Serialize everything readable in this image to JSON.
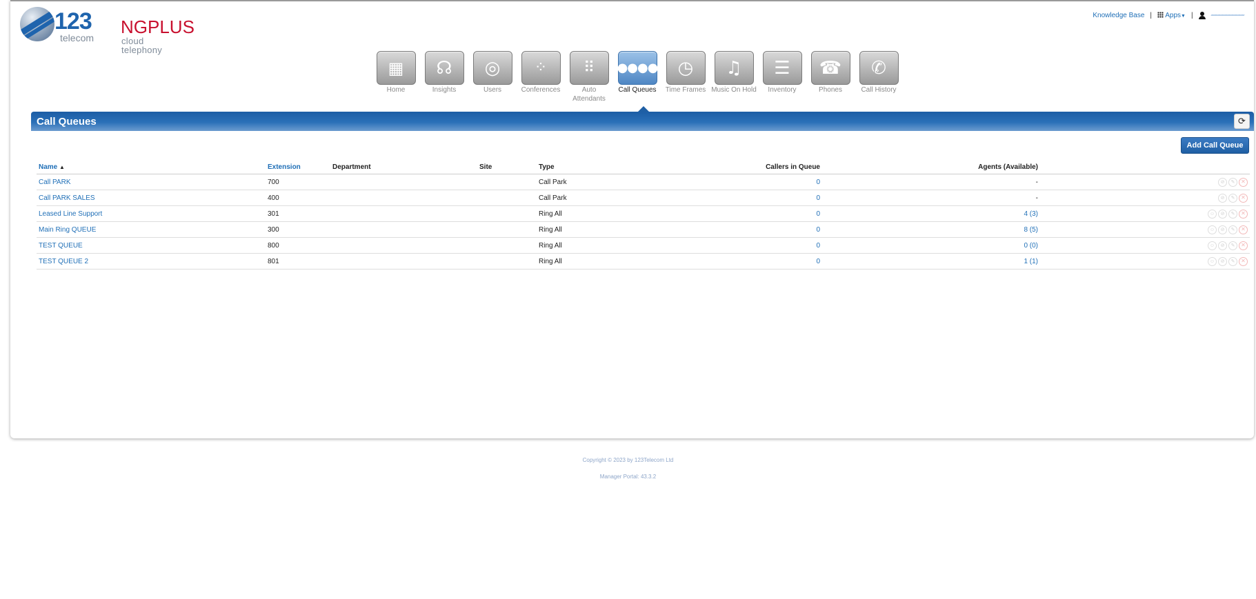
{
  "header": {
    "logo_number": "123",
    "logo_sub": "telecom",
    "brand_name": "NGPLUS",
    "brand_tag": "cloud telephony",
    "knowledge_base": "Knowledge Base",
    "apps": "Apps",
    "user_name": "~~~~~~~~~~"
  },
  "nav": {
    "items": [
      {
        "label": "Home",
        "icon": "building-icon"
      },
      {
        "label": "Insights",
        "icon": "headset-icon"
      },
      {
        "label": "Users",
        "icon": "user-circle-icon"
      },
      {
        "label": "Conferences",
        "icon": "conference-icon"
      },
      {
        "label": "Auto Attendants",
        "icon": "keypad-icon"
      },
      {
        "label": "Call Queues",
        "icon": "dots-icon"
      },
      {
        "label": "Time Frames",
        "icon": "clock-icon"
      },
      {
        "label": "Music On Hold",
        "icon": "music-note-icon"
      },
      {
        "label": "Inventory",
        "icon": "list-icon"
      },
      {
        "label": "Phones",
        "icon": "handset-icon"
      },
      {
        "label": "Call History",
        "icon": "call-history-icon"
      }
    ],
    "active": "Call Queues"
  },
  "page": {
    "title": "Call Queues",
    "add_button": "Add Call Queue"
  },
  "table": {
    "headers": {
      "name": "Name",
      "extension": "Extension",
      "department": "Department",
      "site": "Site",
      "type": "Type",
      "callers": "Callers in Queue",
      "agents": "Agents (Available)"
    },
    "rows": [
      {
        "name": "Call PARK",
        "extension": "700",
        "department": "",
        "site": "",
        "type": "Call Park",
        "callers": "0",
        "agents": "-"
      },
      {
        "name": "Call PARK SALES",
        "extension": "400",
        "department": "",
        "site": "",
        "type": "Call Park",
        "callers": "0",
        "agents": "-"
      },
      {
        "name": "Leased Line Support",
        "extension": "301",
        "department": "",
        "site": "",
        "type": "Ring All",
        "callers": "0",
        "agents": "4 (3)"
      },
      {
        "name": "Main Ring QUEUE",
        "extension": "300",
        "department": "",
        "site": "",
        "type": "Ring All",
        "callers": "0",
        "agents": "8 (5)"
      },
      {
        "name": "TEST QUEUE",
        "extension": "800",
        "department": "",
        "site": "",
        "type": "Ring All",
        "callers": "0",
        "agents": "0 (0)"
      },
      {
        "name": "TEST QUEUE 2",
        "extension": "801",
        "department": "",
        "site": "",
        "type": "Ring All",
        "callers": "0",
        "agents": "1 (1)"
      }
    ]
  },
  "footer": {
    "copyright": "Copyright © 2023 by 123Telecom Ltd",
    "version": "Manager Portal: 43.3.2"
  }
}
